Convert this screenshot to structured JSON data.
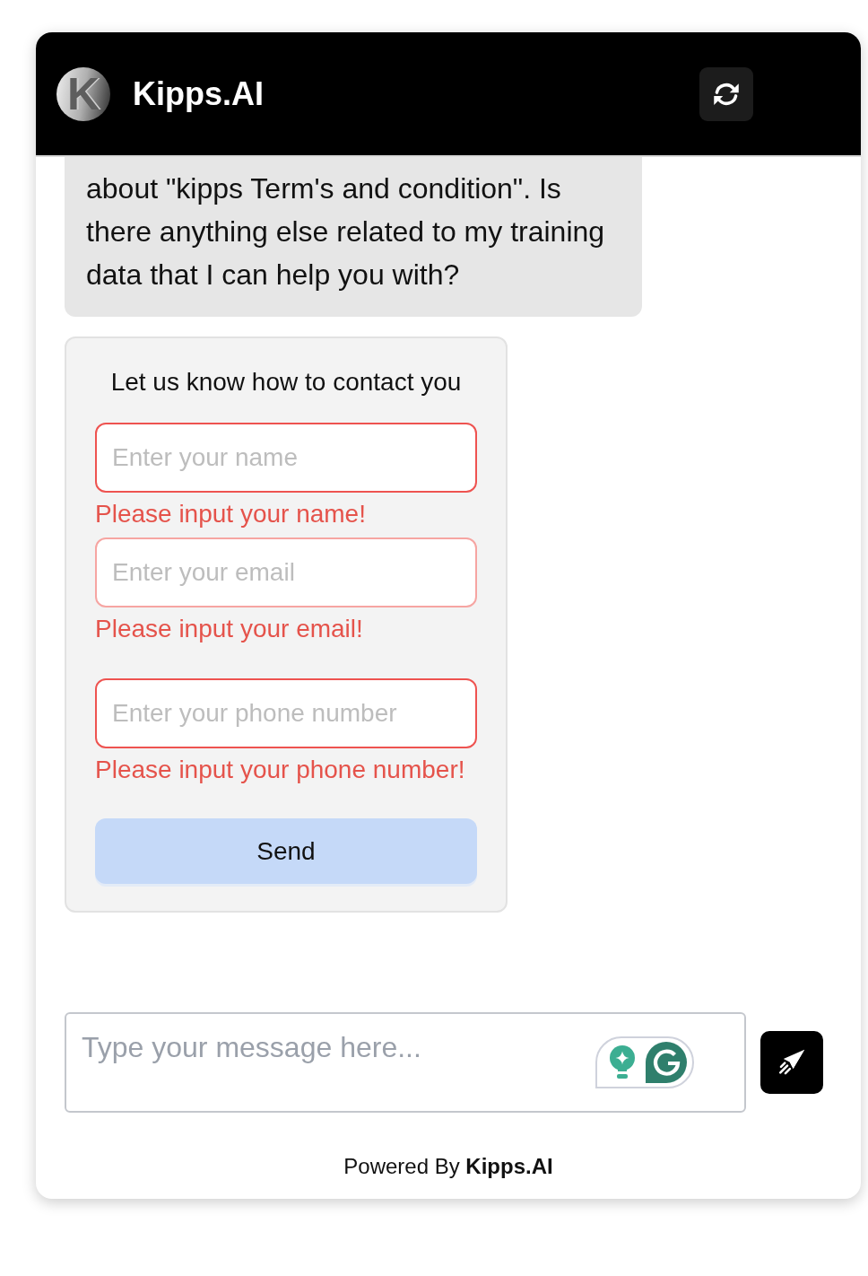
{
  "header": {
    "logo_letter": "K",
    "title": "Kipps.AI"
  },
  "messages": [
    {
      "kind": "bot",
      "text": "about \"kipps Term's and condition\". Is there anything else related to my training data that I can help you with?"
    }
  ],
  "contact_form": {
    "title": "Let us know how to contact you",
    "fields": [
      {
        "kind": "name",
        "placeholder": "Enter your name",
        "error": "Please input your name!",
        "hovered": false
      },
      {
        "kind": "email",
        "placeholder": "Enter your email",
        "error": "Please input your email!",
        "hovered": true
      },
      {
        "kind": "phone",
        "placeholder": "Enter your phone number",
        "error": "Please input your phone number!",
        "hovered": false
      }
    ],
    "submit": "Send"
  },
  "composer": {
    "placeholder": "Type your message here..."
  },
  "footer": {
    "text": "Powered By **Kipps.AI**"
  }
}
